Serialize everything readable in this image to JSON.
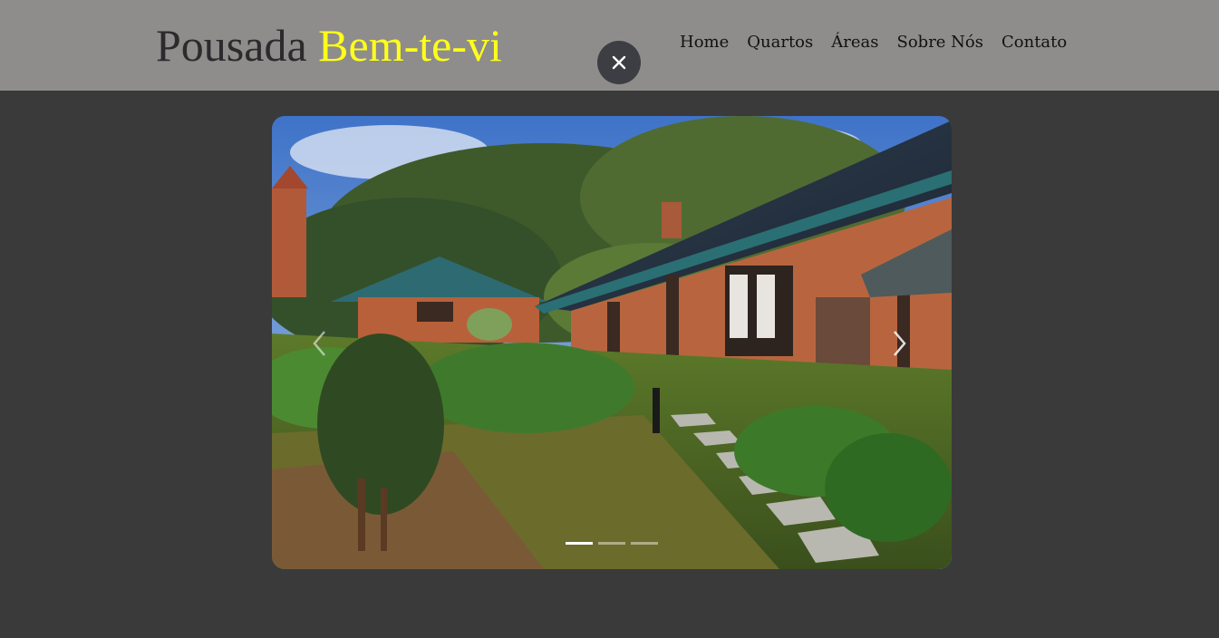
{
  "brand": {
    "name_main": "Pousada ",
    "name_accent": "Bem-te-vi",
    "accent_color": "#ffff1a"
  },
  "nav": {
    "items": [
      {
        "label": "Home"
      },
      {
        "label": "Quartos"
      },
      {
        "label": "Áreas"
      },
      {
        "label": "Sobre Nós"
      },
      {
        "label": "Contato"
      }
    ]
  },
  "lightbox": {
    "close_icon": "close-icon",
    "prev_icon": "chevron-left-icon",
    "next_icon": "chevron-right-icon",
    "slide_count": 3,
    "active_slide": 1
  },
  "colors": {
    "header_bg": "#8e8d8b",
    "page_bg": "#3a3a3a"
  }
}
